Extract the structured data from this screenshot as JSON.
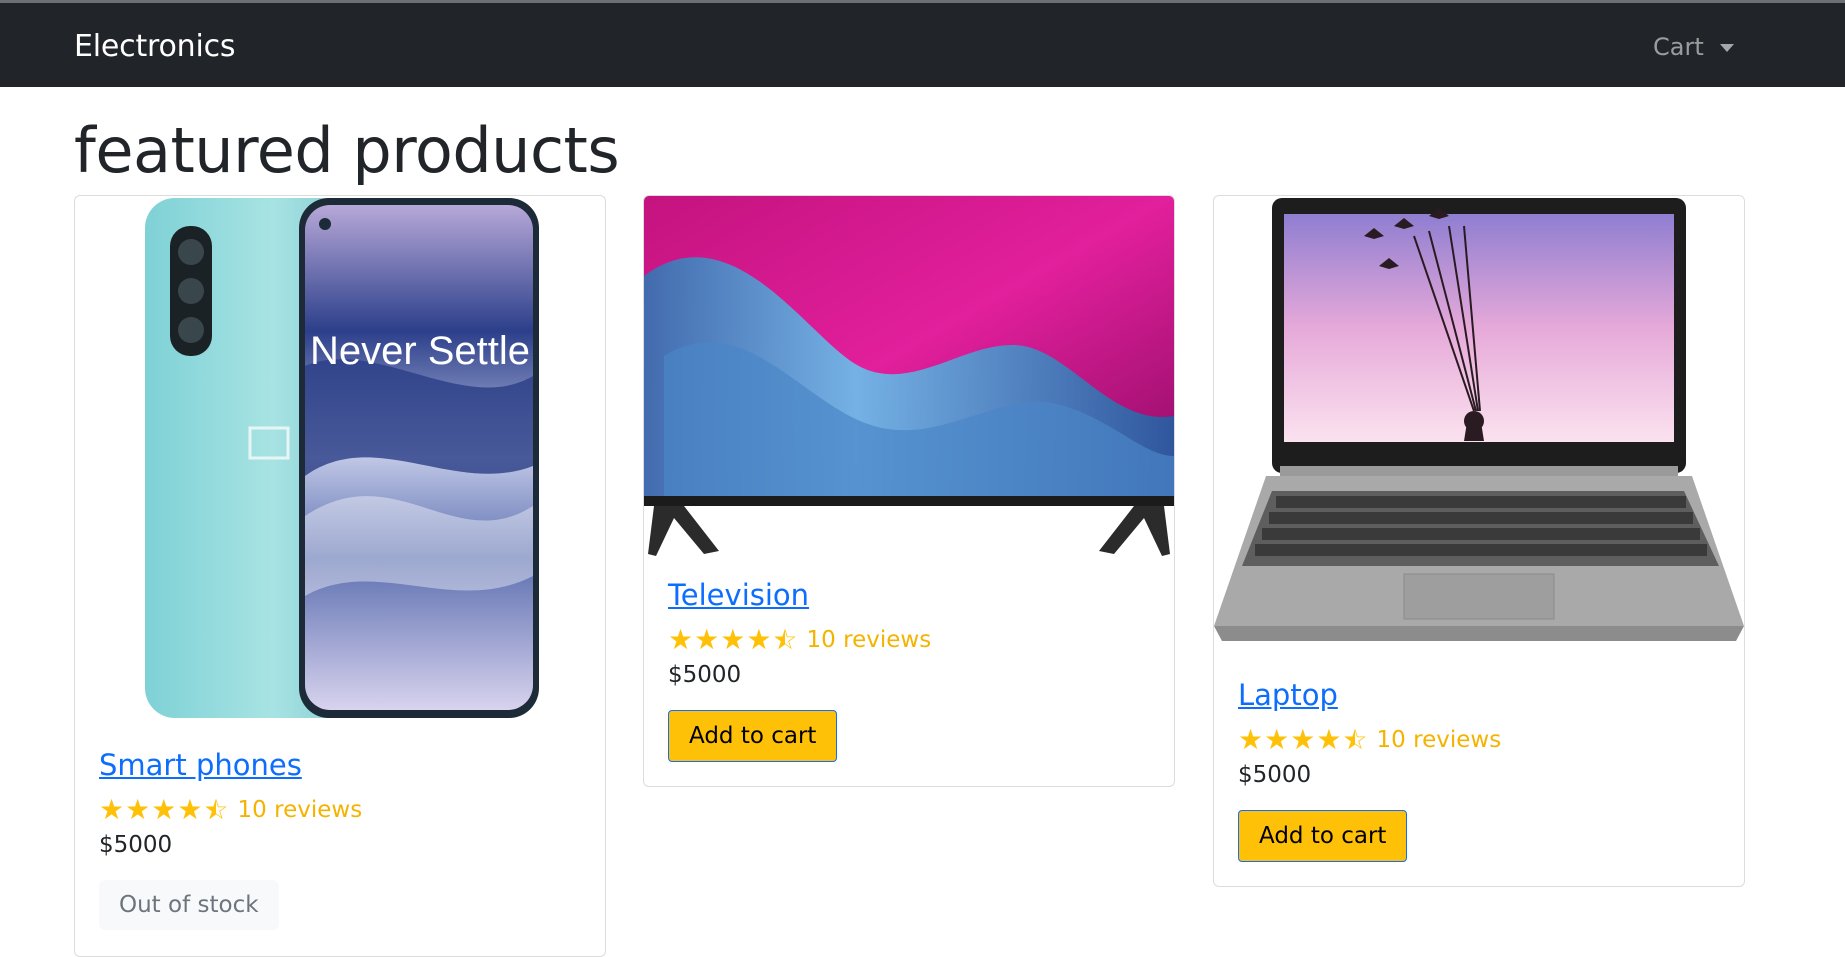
{
  "navbar": {
    "brand": "Electronics",
    "cart_label": "Cart"
  },
  "page": {
    "title": "featured products"
  },
  "products": [
    {
      "name": "Smart phones",
      "rating": 4.5,
      "reviews": "10 reviews",
      "price": "$5000",
      "action": "Out of stock",
      "image_icon": "phone-image",
      "image_text": "Never Settle"
    },
    {
      "name": "Television",
      "rating": 4.5,
      "reviews": "10 reviews",
      "price": "$5000",
      "action": "Add to cart",
      "image_icon": "television-image"
    },
    {
      "name": "Laptop",
      "rating": 4.5,
      "reviews": "10 reviews",
      "price": "$5000",
      "action": "Add to cart",
      "image_icon": "laptop-image"
    }
  ],
  "colors": {
    "navbar": "#212529",
    "link": "#0d6efd",
    "accent": "#ffc107"
  }
}
